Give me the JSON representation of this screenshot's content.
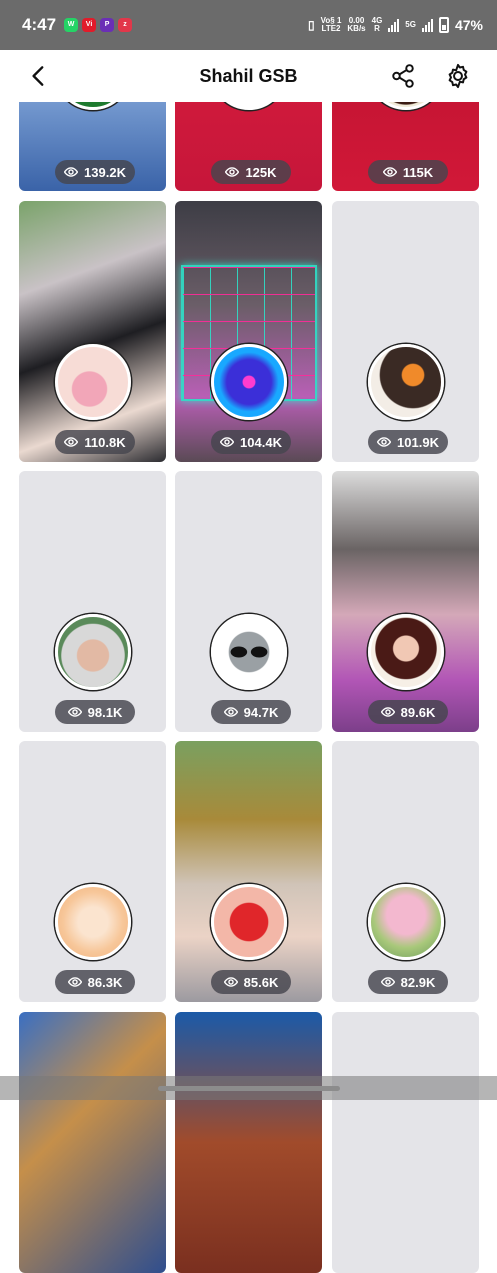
{
  "status": {
    "time": "4:47",
    "net_top": "Vo§ 1",
    "net_bottom": "LTE2",
    "speed_top": "0.00",
    "speed_bottom": "KB/s",
    "sig1": "4G",
    "sig2": "5G",
    "battery": "47%"
  },
  "header": {
    "title": "Shahil GSB"
  },
  "tiles": [
    {
      "views": "139.2K"
    },
    {
      "views": "125K"
    },
    {
      "views": "115K"
    },
    {
      "views": "110.8K"
    },
    {
      "views": "104.4K"
    },
    {
      "views": "101.9K"
    },
    {
      "views": "98.1K"
    },
    {
      "views": "94.7K"
    },
    {
      "views": "89.6K"
    },
    {
      "views": "86.3K"
    },
    {
      "views": "85.6K"
    },
    {
      "views": "82.9K"
    }
  ],
  "icons": {
    "back": "chevron-left-icon",
    "share": "share-icon",
    "settings": "gear-icon",
    "views": "eye-icon"
  }
}
